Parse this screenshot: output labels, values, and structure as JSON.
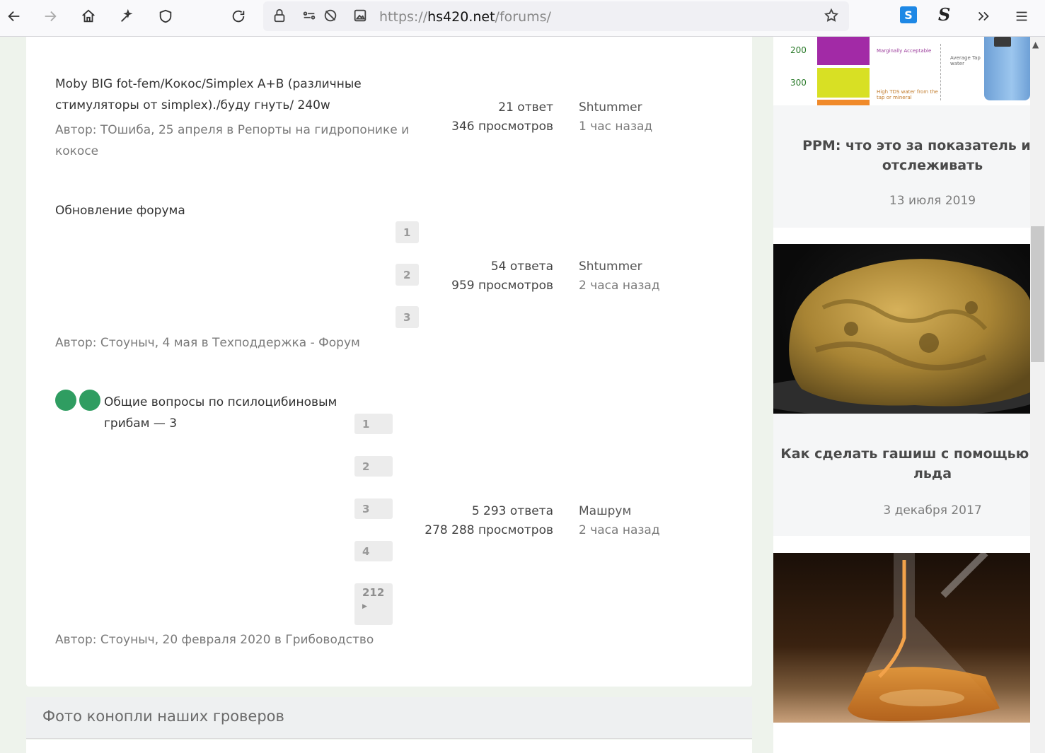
{
  "browser": {
    "url_scheme": "https://",
    "url_host": "hs420.net",
    "url_path": "/forums/",
    "ext_s1_label": "S",
    "ext_s2_label": "S"
  },
  "topics": [
    {
      "title": "Moby BIG fot-fem/Кокос/Simplex A+B (различные стимуляторы от simplex)./буду гнуть/ 240w",
      "meta": "Автор: ТОшиба, 25 апреля в Репорты на гидропонике и кокосе",
      "replies": "21 ответ",
      "views": "346 просмотров",
      "last_user": "Shtummer",
      "last_time": "1 час назад"
    },
    {
      "title": "Обновление форума",
      "pages": [
        "1",
        "2",
        "3"
      ],
      "meta": "Автор: Стоуныч, 4 мая в Техподдержка - Форум",
      "replies": "54 ответа",
      "views": "959 просмотров",
      "last_user": "Shtummer",
      "last_time": "2 часа назад"
    },
    {
      "title": "Общие вопросы по псилоцибиновым грибам — 3",
      "pages": [
        "1",
        "2",
        "3",
        "4",
        "212"
      ],
      "meta": "Автор: Стоуныч, 20 февраля 2020 в Грибоводство",
      "replies": "5 293 ответа",
      "views": "278 288 просмотров",
      "last_user": "Машрум",
      "last_time": "2 часа назад"
    }
  ],
  "section": {
    "title": "Фото конопли наших гроверов"
  },
  "sidebar": {
    "chart_labels": [
      "200",
      "300"
    ],
    "chart_notes": [
      "Marginally Acceptable",
      "Average Tap water",
      "High TDS water from the tap or mineral"
    ],
    "cards": [
      {
        "title": "PPM: что это за показатель и как отслеживать",
        "date": "13 июля 2019"
      },
      {
        "title": "Как сделать гашиш с помощью сухого льда",
        "date": "3 декабря 2017"
      }
    ]
  },
  "colors": {
    "accent_green": "#2f9d61",
    "page_bg": "#eef3ec"
  }
}
